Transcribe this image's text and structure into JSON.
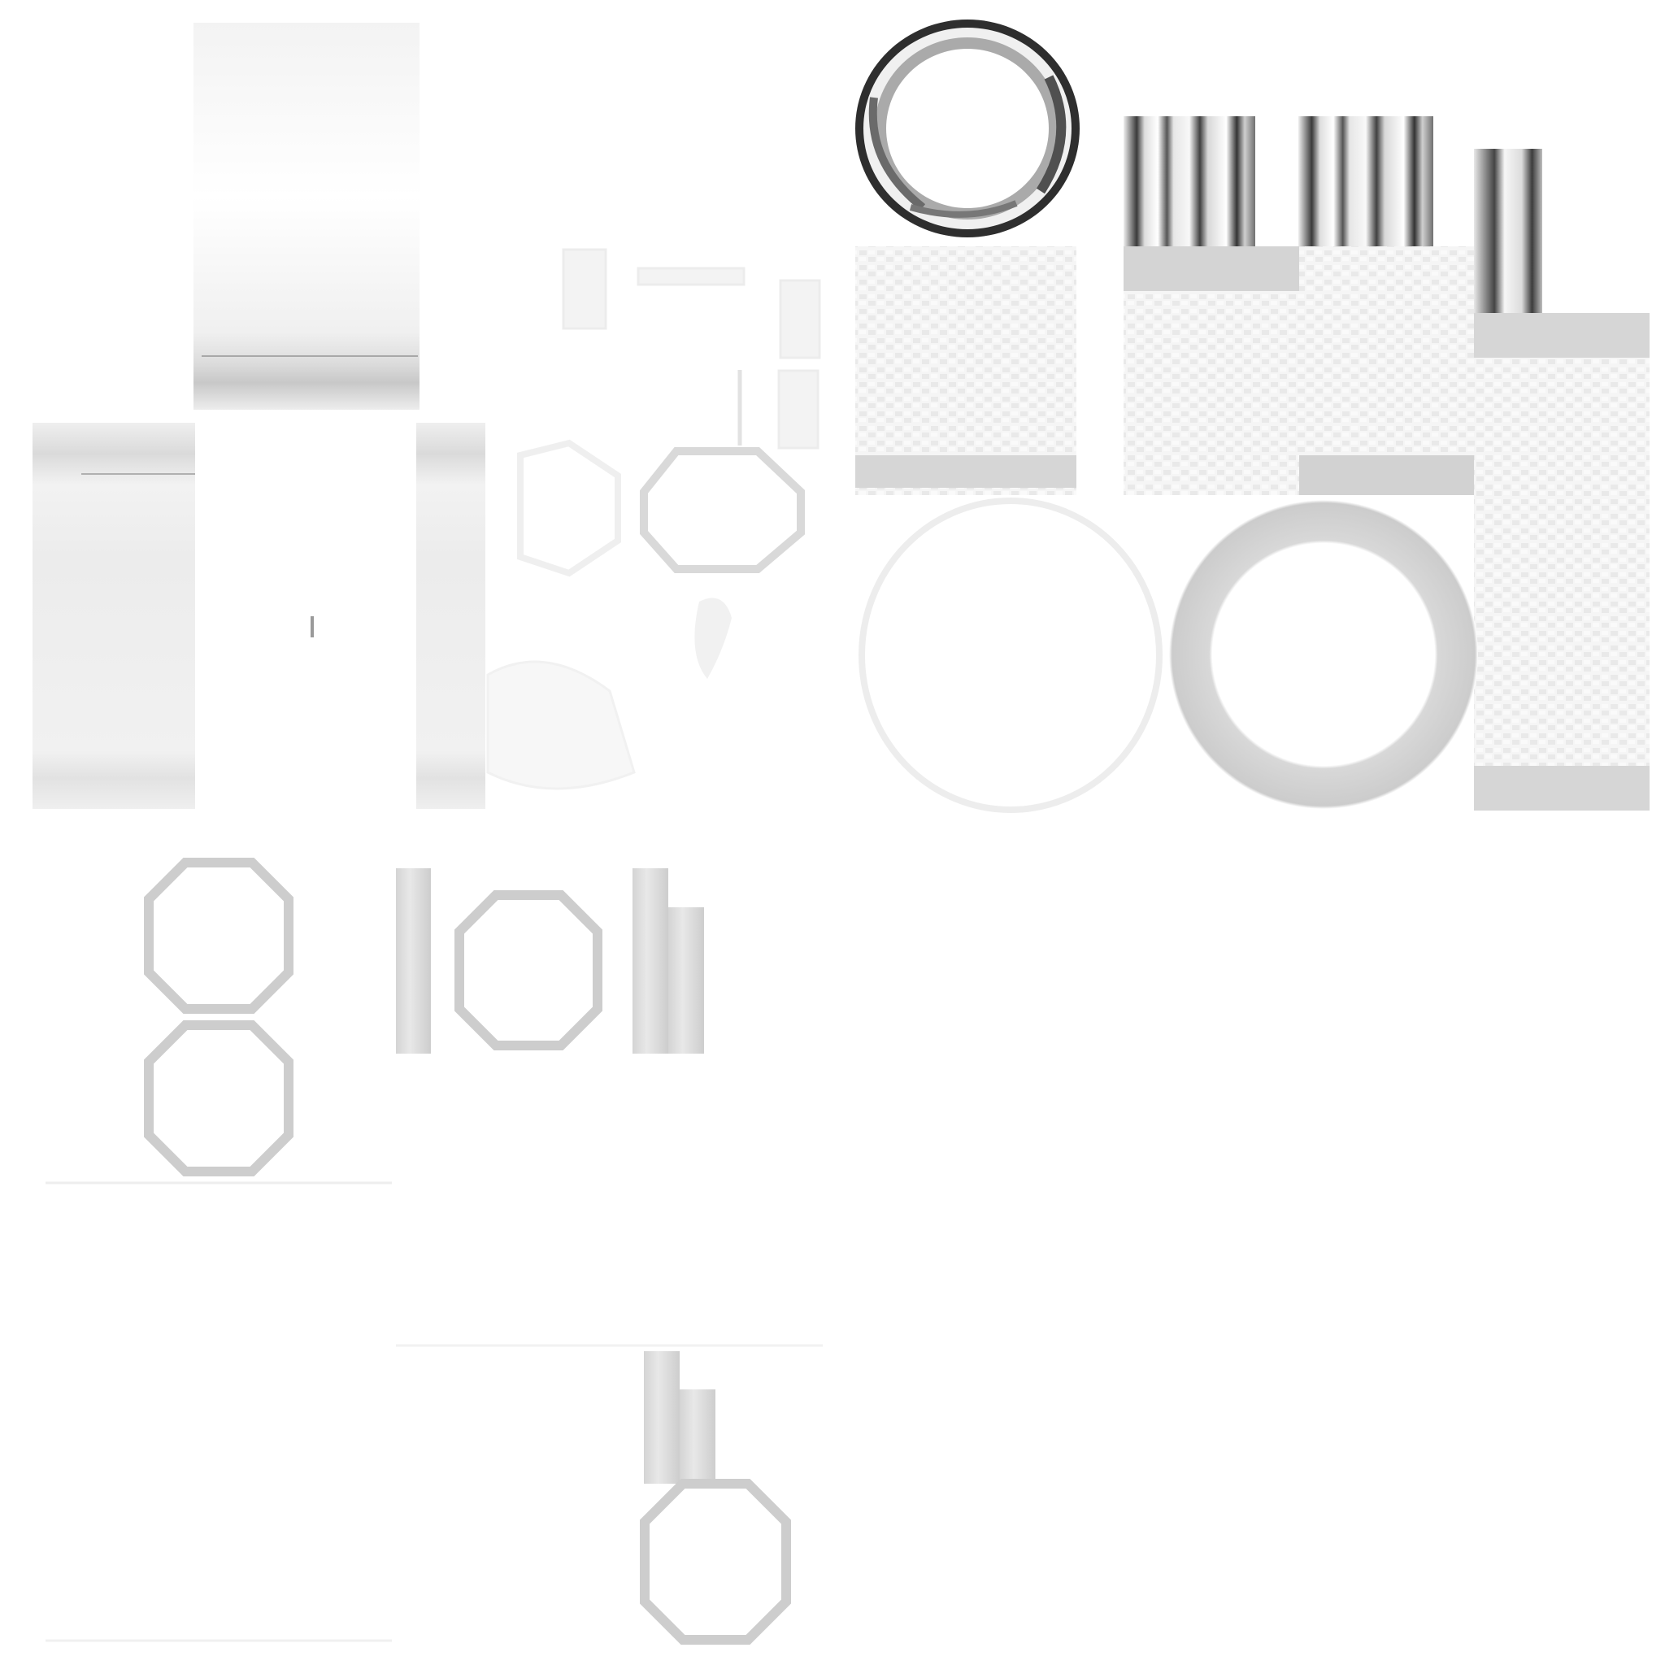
{
  "image": {
    "kind": "texture atlas",
    "background_color": "#ffffff",
    "colors": {
      "light_gray": "#e6e6e6",
      "mid_gray": "#cfcfcf",
      "ring_gray": "#c9c9c9",
      "dark_gray": "#555555",
      "near_black": "#2b2b2b",
      "faint": "#f4f4f4"
    }
  }
}
